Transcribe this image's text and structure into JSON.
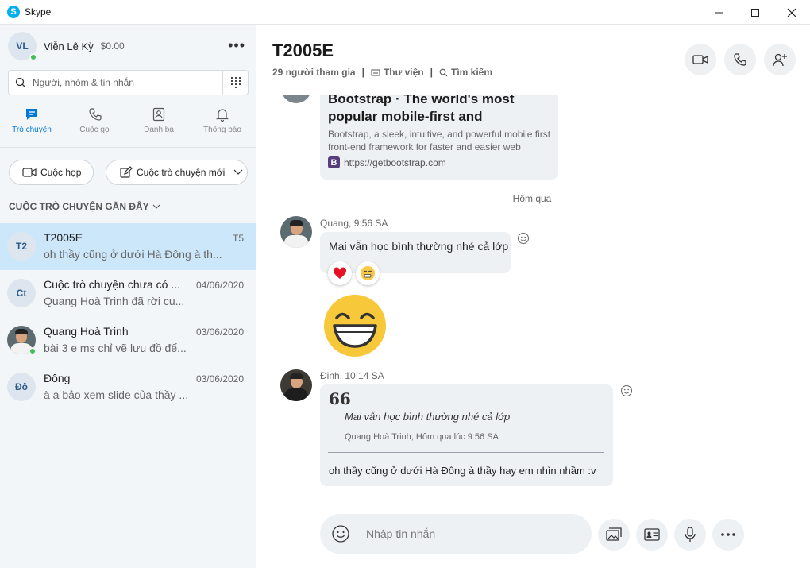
{
  "window": {
    "title": "Skype",
    "app_icon_letter": "S",
    "controls": [
      "minimize",
      "maximize",
      "close"
    ]
  },
  "profile": {
    "initials": "VL",
    "name": "Viễn Lê Kỳ",
    "credit": "$0.00",
    "status": "online",
    "more_label": "•••"
  },
  "search": {
    "placeholder": "Người, nhóm & tin nhắn",
    "dialpad_icon": "dialpad-icon"
  },
  "nav_tabs": [
    {
      "label": "Trò chuyện",
      "icon": "chat-icon",
      "active": true
    },
    {
      "label": "Cuộc gọi",
      "icon": "phone-icon",
      "active": false
    },
    {
      "label": "Danh bạ",
      "icon": "contacts-icon",
      "active": false
    },
    {
      "label": "Thông báo",
      "icon": "bell-icon",
      "active": false
    }
  ],
  "actions": {
    "meet_label": "Cuộc họp",
    "new_chat_label": "Cuộc trò chuyện mới"
  },
  "recent": {
    "header": "CUỘC TRÒ CHUYỆN GẦN ĐÂY",
    "conversations": [
      {
        "avatar": "T2",
        "title": "T2005E",
        "date": "T5",
        "preview": "oh thầy cũng ở dưới Hà Đông à th...",
        "selected": true
      },
      {
        "avatar": "Ct",
        "title": "Cuộc trò chuyện chưa có ...",
        "date": "04/06/2020",
        "preview": "Quang Hoà Trinh đã rời cu...",
        "selected": false
      },
      {
        "avatar": "photo",
        "title": "Quang Hoà Trinh",
        "date": "03/06/2020",
        "preview": "bài 3 e ms chỉ vẽ lưu đồ đế...",
        "selected": false,
        "online": true
      },
      {
        "avatar": "Đô",
        "title": "Đông",
        "date": "03/06/2020",
        "preview": "à a bảo xem slide của thầy ...",
        "selected": false
      }
    ]
  },
  "chat": {
    "title": "T2005E",
    "participants": "29 người tham gia",
    "gallery_label": "Thư viện",
    "search_label": "Tìm kiếm",
    "header_buttons": [
      "video-call-icon",
      "audio-call-icon",
      "add-person-icon"
    ]
  },
  "link_preview": {
    "title": "Bootstrap · The world's most popular mobile-first and",
    "description": "Bootstrap, a sleek, intuitive, and powerful mobile first front-end framework for faster and easier web",
    "url": "https://getbootstrap.com",
    "favicon_letter": "B"
  },
  "day_divider": "Hôm qua",
  "messages": [
    {
      "sender_meta": "Quang, 9:56 SA",
      "text": "Mai vẫn học bình thường nhé cả lớp",
      "reactions": [
        "heart",
        "sad-face"
      ],
      "followup_emoji": "laughing-emoji"
    },
    {
      "sender_meta": "Đinh, 10:14 SA",
      "quote_mark": "66",
      "quoted_text": "Mai vẫn học bình thường nhé cả lớp",
      "quote_source": "Quang Hoà Trinh, Hôm qua lúc 9:56 SA",
      "text": "oh thầy cũng ở dưới Hà Đông à thầy hay em nhìn nhầm :v"
    }
  ],
  "composer": {
    "placeholder": "Nhập tin nhắn",
    "buttons": [
      "emoji-icon",
      "media-icon",
      "contact-card-icon",
      "microphone-icon",
      "more-icon"
    ]
  },
  "colors": {
    "accent": "#0078d4",
    "selected_row": "#cce7f9",
    "sidebar_bg": "#f3f6f9",
    "bubble_bg": "#eef1f4",
    "online": "#40c057",
    "skype_blue": "#00aff0"
  }
}
